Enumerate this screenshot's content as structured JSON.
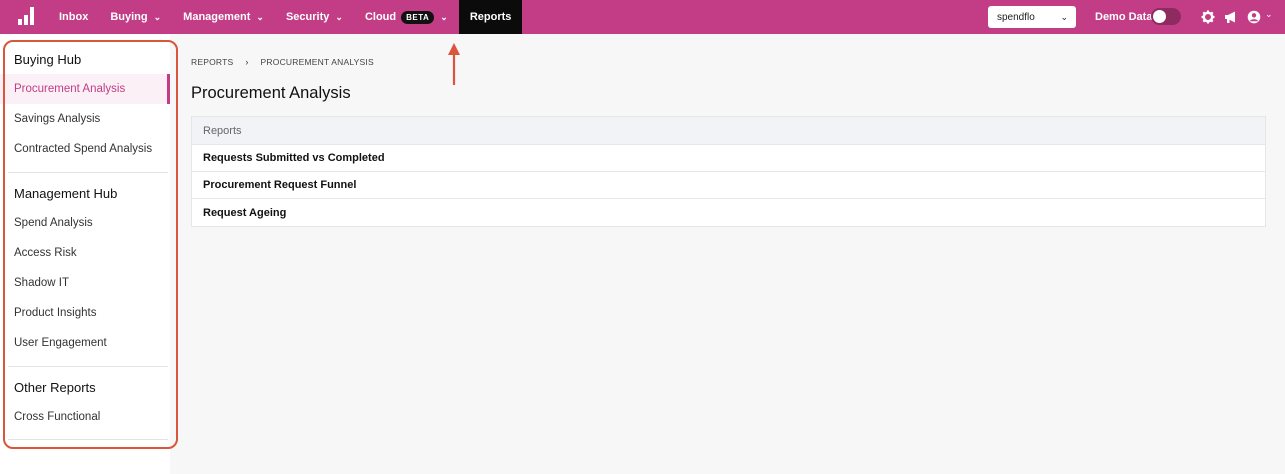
{
  "topnav": {
    "items": [
      {
        "label": "Inbox",
        "has_dropdown": false
      },
      {
        "label": "Buying",
        "has_dropdown": true
      },
      {
        "label": "Management",
        "has_dropdown": true
      },
      {
        "label": "Security",
        "has_dropdown": true
      },
      {
        "label": "Cloud",
        "has_dropdown": true,
        "badge": "BETA"
      },
      {
        "label": "Reports",
        "has_dropdown": false,
        "active": true
      }
    ],
    "org_select_value": "spendflo",
    "demo_label": "Demo Data",
    "demo_toggle_on": false,
    "icons": [
      "gear-icon",
      "megaphone-icon",
      "user-icon"
    ],
    "bg_color": "#c23d85"
  },
  "sidebar": {
    "sections": [
      {
        "title": "Buying Hub",
        "items": [
          "Procurement Analysis",
          "Savings Analysis",
          "Contracted Spend Analysis"
        ]
      },
      {
        "title": "Management Hub",
        "items": [
          "Spend Analysis",
          "Access Risk",
          "Shadow IT",
          "Product Insights",
          "User Engagement"
        ]
      },
      {
        "title": "Other Reports",
        "items": [
          "Cross Functional"
        ]
      }
    ],
    "active_item": "Procurement Analysis"
  },
  "breadcrumb": [
    "REPORTS",
    "PROCUREMENT ANALYSIS"
  ],
  "page_title": "Procurement Analysis",
  "reports_table": {
    "header": "Reports",
    "rows": [
      "Requests Submitted vs Completed",
      "Procurement Request Funnel",
      "Request Ageing"
    ]
  }
}
